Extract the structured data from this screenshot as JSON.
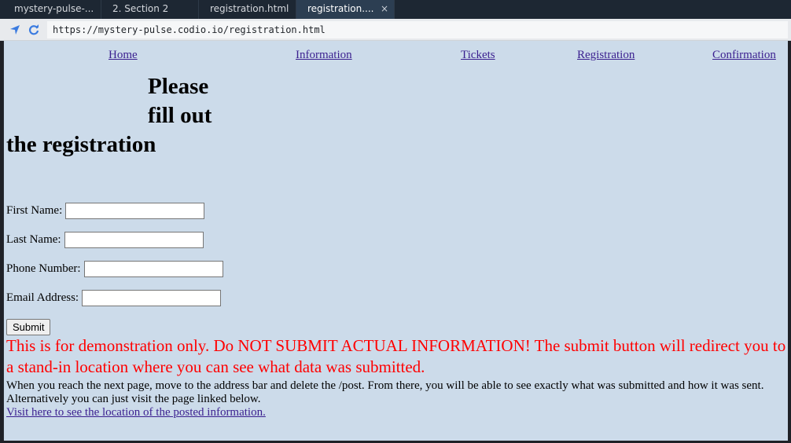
{
  "browser": {
    "tabs": [
      {
        "label": "mystery-pulse-..."
      },
      {
        "label": "2. Section 2"
      },
      {
        "label": "registration.html"
      },
      {
        "label": "registration....",
        "active": true
      }
    ],
    "close_glyph": "×",
    "url": "https://mystery-pulse.codio.io/registration.html",
    "icons": [
      "navigate-icon",
      "refresh-icon"
    ]
  },
  "nav": {
    "links": [
      "Home",
      "Information",
      "Tickets",
      "Registration",
      "Confirmation"
    ]
  },
  "heading": {
    "line1": "Please",
    "line2": "fill out",
    "line3": "the registration"
  },
  "form": {
    "fields": [
      {
        "label": "First Name:",
        "value": ""
      },
      {
        "label": "Last Name:",
        "value": ""
      },
      {
        "label": "Phone Number:",
        "value": ""
      },
      {
        "label": "Email Address:",
        "value": ""
      }
    ],
    "submit_label": "Submit"
  },
  "warning": "This is for demonstration only. Do NOT SUBMIT ACTUAL INFORMATION! The submit button will redirect you to a stand-in location where you can see what data was submitted.",
  "note": "When you reach the next page, move to the address bar and delete the /post. From there, you will be able to see exactly what was submitted and how it was sent. Alternatively you can just visit the page linked below.",
  "posted_link": "Visit here to see the location of the posted information.",
  "colors": {
    "page_bg": "#ccdbea",
    "warning": "#ff0000",
    "link": "#3a1f8f",
    "tabbar": "#1d2733",
    "active_tab": "#2c3e52"
  }
}
